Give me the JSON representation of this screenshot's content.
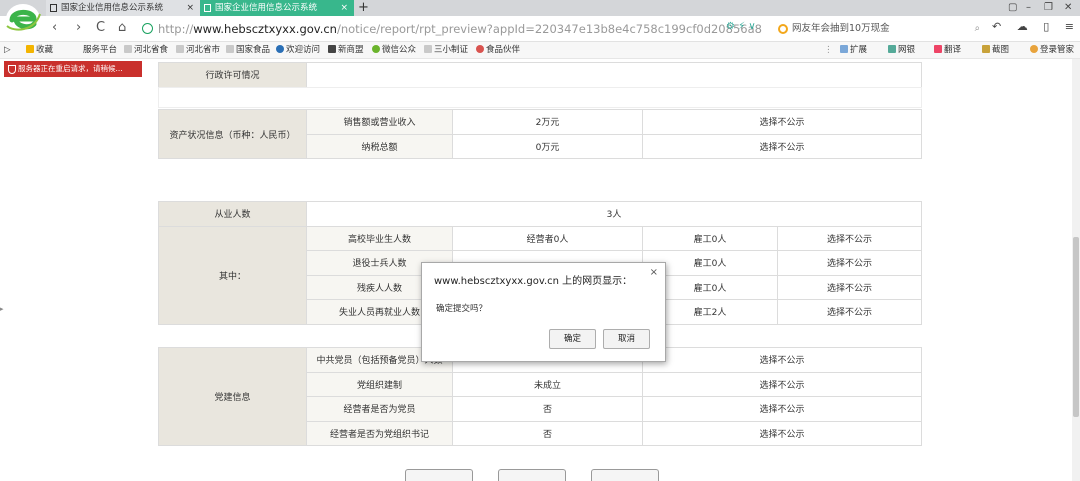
{
  "browser": {
    "tabs": [
      {
        "title": "国家企业信用信息公示系统",
        "close": "×"
      },
      {
        "title": "国家企业信用信息公示系统",
        "close": "×"
      }
    ],
    "new_tab": "+",
    "window_buttons": [
      "▢",
      "–",
      "❐",
      "✕"
    ],
    "nav": {
      "back": "‹",
      "forward": "›",
      "refresh": "C",
      "home": "⌂"
    },
    "url_prefix": "http://",
    "url_host": "www.hebscztxyxx.gov.cn",
    "url_path": "/notice/report/rpt_preview?appId=220347e13b8e4c758c199cf0d20856a8",
    "search_placeholder": "网友年会抽到10万现金",
    "addr_icons": "⚙ ⚡ ∨",
    "tool_icons": "↶ ☁ ▯ ≡"
  },
  "bookmarks": [
    "收藏",
    "服务平台",
    "河北省食",
    "河北省市",
    "国家食品",
    "欢迎访问",
    "新商盟",
    "微信公众",
    "三小制证",
    "食品伙伴"
  ],
  "bookmarks_right": [
    "扩展",
    "网银",
    "翻译",
    "截图",
    "登录管家"
  ],
  "page": {
    "notice": "服务器正在重启请求，请稍候...",
    "section_admin": {
      "label": "行政许可情况"
    },
    "section_assets": {
      "label": "资产状况信息（币种：人民币）",
      "rows": [
        {
          "name": "销售额或营业收入",
          "value": "2万元",
          "status": "选择不公示"
        },
        {
          "name": "纳税总额",
          "value": "0万元",
          "status": "选择不公示"
        }
      ]
    },
    "section_staff": {
      "label": "从业人数",
      "total": "3人",
      "sub_label": "其中：",
      "rows": [
        {
          "name": "高校毕业生人数",
          "operator": "经营者0人",
          "employee": "雇工0人",
          "status": "选择不公示"
        },
        {
          "name": "退役士兵人数",
          "operator": "",
          "employee": "雇工0人",
          "status": "选择不公示"
        },
        {
          "name": "残疾人人数",
          "operator": "",
          "employee": "雇工0人",
          "status": "选择不公示"
        },
        {
          "name": "失业人员再就业人数",
          "operator": "",
          "employee": "雇工2人",
          "status": "选择不公示"
        }
      ]
    },
    "section_party": {
      "label": "党建信息",
      "rows": [
        {
          "name": "中共党员（包括预备党员）人数",
          "value": "",
          "status": "选择不公示"
        },
        {
          "name": "党组织建制",
          "value": "未成立",
          "status": "选择不公示"
        },
        {
          "name": "经营者是否为党员",
          "value": "否",
          "status": "选择不公示"
        },
        {
          "name": "经营者是否为党组织书记",
          "value": "否",
          "status": "选择不公示"
        }
      ]
    },
    "bottom_buttons": [
      "",
      "",
      ""
    ]
  },
  "dialog": {
    "title": "www.hebscztxyxx.gov.cn 上的网页显示：",
    "close": "×",
    "message": "确定提交吗？",
    "ok": "确定",
    "cancel": "取消"
  }
}
